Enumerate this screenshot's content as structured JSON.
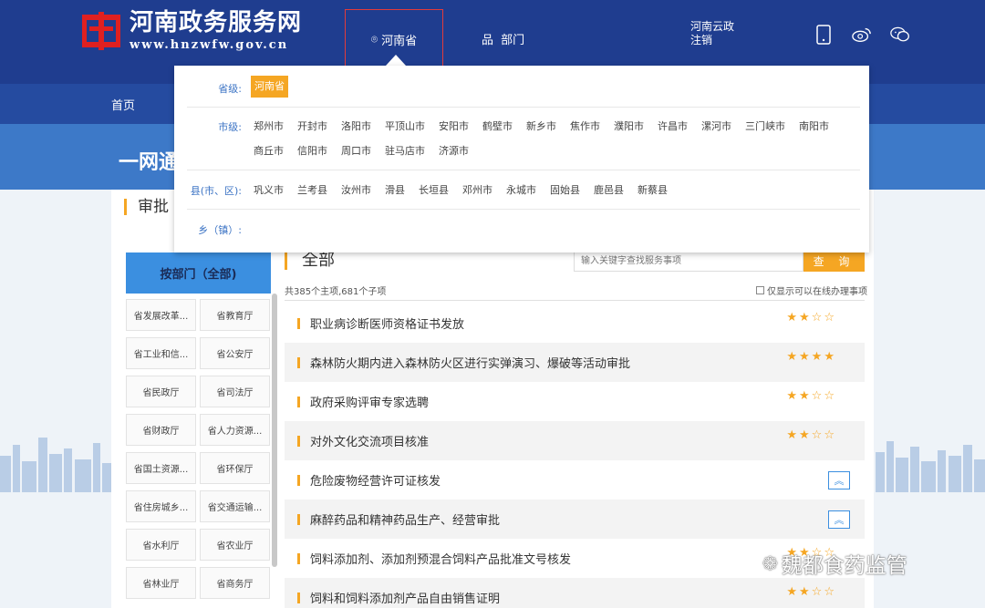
{
  "header": {
    "site_title": "河南政务服务网",
    "site_url": "www.hnzwfw.gov.cn",
    "location_tab": "河南省",
    "dept_tab": "部门",
    "cloud_label": "河南云政",
    "logout_label": "注销",
    "icons": [
      "mobile-icon",
      "weibo-icon",
      "wechat-icon"
    ]
  },
  "nav": {
    "home": "首页"
  },
  "hero": {
    "text": "一网通"
  },
  "section_title": "审批",
  "dropdown": {
    "province_label": "省级:",
    "province_selected": "河南省",
    "city_label": "市级:",
    "cities": [
      "郑州市",
      "开封市",
      "洛阳市",
      "平顶山市",
      "安阳市",
      "鹤壁市",
      "新乡市",
      "焦作市",
      "濮阳市",
      "许昌市",
      "漯河市",
      "三门峡市",
      "南阳市",
      "商丘市",
      "信阳市",
      "周口市",
      "驻马店市",
      "济源市"
    ],
    "county_label": "县(市、区):",
    "counties": [
      "巩义市",
      "兰考县",
      "汝州市",
      "滑县",
      "长垣县",
      "邓州市",
      "永城市",
      "固始县",
      "鹿邑县",
      "新蔡县"
    ],
    "town_label": "乡（镇）:"
  },
  "sidebar": {
    "header": "按部门（全部)",
    "departments": [
      "省发展改革...",
      "省教育厅",
      "省工业和信...",
      "省公安厅",
      "省民政厅",
      "省司法厅",
      "省财政厅",
      "省人力资源...",
      "省国土资源...",
      "省环保厅",
      "省住房城乡...",
      "省交通运输...",
      "省水利厅",
      "省农业厅",
      "省林业厅",
      "省商务厅"
    ]
  },
  "content": {
    "title": "全部",
    "search_placeholder": "输入关键字查找服务事项",
    "search_button": "查 询",
    "summary": "共385个主项,681个子项",
    "online_only": "仅显示可以在线办理事项",
    "services": [
      {
        "name": "职业病诊断医师资格证书发放",
        "stars": "★★☆☆"
      },
      {
        "name": "森林防火期内进入森林防火区进行实弹演习、爆破等活动审批",
        "stars": "★★★★"
      },
      {
        "name": "政府采购评审专家选聘",
        "stars": "★★☆☆"
      },
      {
        "name": "对外文化交流项目核准",
        "stars": "★★☆☆"
      },
      {
        "name": "危险废物经营许可证核发",
        "stars": ""
      },
      {
        "name": "麻醉药品和精神药品生产、经营审批",
        "stars": ""
      },
      {
        "name": "饲料添加剂、添加剂预混合饲料产品批准文号核发",
        "stars": "★★☆☆"
      },
      {
        "name": "饲料和饲料添加剂产品自由销售证明",
        "stars": "★★☆☆"
      }
    ]
  },
  "watermark": "魏都食药监管",
  "colors": {
    "header": "#1f3d8f",
    "accent": "#f5a623",
    "link": "#3b73c4"
  }
}
